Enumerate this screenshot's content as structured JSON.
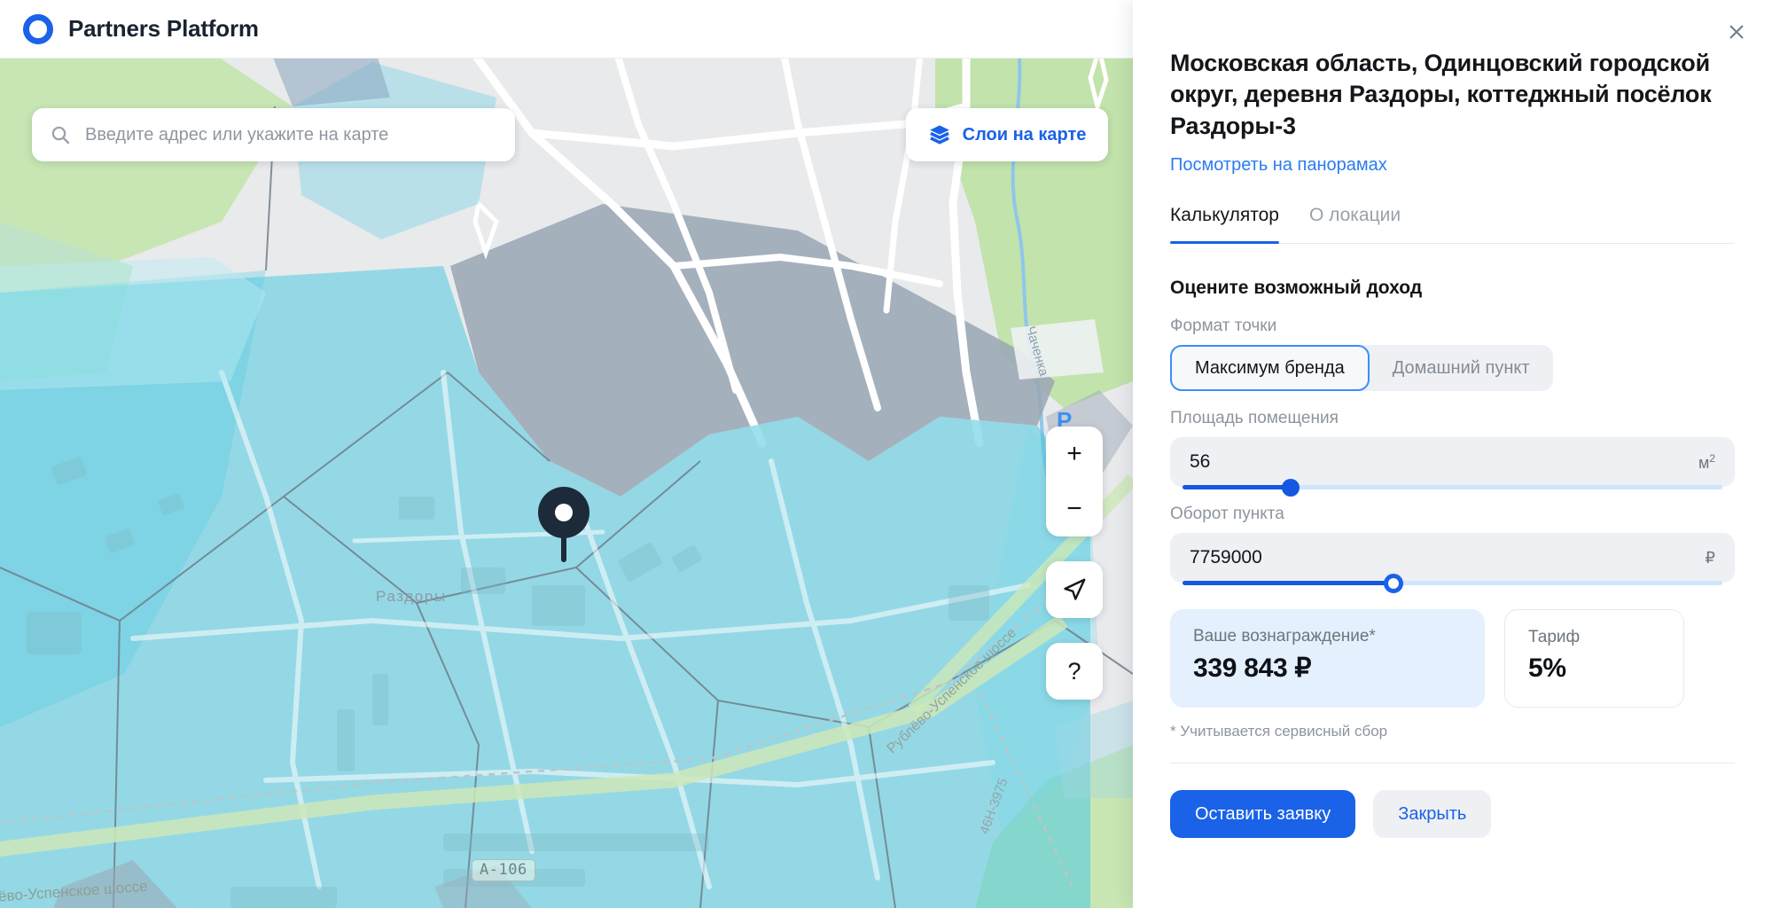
{
  "header": {
    "brand": "Partners Platform",
    "logo_icon": "ring-logo-icon",
    "logo_color": "#1a62e8"
  },
  "map": {
    "search": {
      "placeholder": "Введите адрес или укажите на карте",
      "value": "",
      "icon": "search-icon"
    },
    "layers_button": {
      "label": "Слои на карте",
      "icon": "layers-icon",
      "color": "#1a62e8"
    },
    "controls": {
      "zoom_in": "+",
      "zoom_out": "−",
      "locate_icon": "navigation-arrow-icon",
      "help": "?"
    },
    "pin": {
      "icon": "map-pin-icon",
      "color": "#1d2a3a"
    },
    "labels": {
      "settlement": "Раздоры",
      "river": "Чаченка",
      "highway_diagonal": "Рублёво-Успенское шоссе",
      "road_46h": "46H-3975",
      "highway_bottom": "лёво-Успенское шоссе",
      "road_shield": "A-106",
      "parking": "P"
    }
  },
  "panel": {
    "close_icon": "close-icon",
    "title": "Московская область, Одинцовский городской округ, деревня Раздоры, коттеджный посёлок Раздоры-3",
    "panorama_link": "Посмотреть на панорамах",
    "tabs": [
      {
        "label": "Калькулятор",
        "active": true
      },
      {
        "label": "О локации",
        "active": false
      }
    ],
    "section_title": "Оцените возможный доход",
    "point_format": {
      "label": "Формат точки",
      "options": [
        {
          "label": "Максимум бренда",
          "selected": true
        },
        {
          "label": "Домашний пункт",
          "selected": false
        }
      ]
    },
    "area": {
      "label": "Площадь помещения",
      "value": "56",
      "unit": "м",
      "unit_sup": "2",
      "slider_percent": 20
    },
    "turnover": {
      "label": "Оборот пункта",
      "value": "7759000",
      "unit": "₽",
      "slider_percent": 39
    },
    "reward_card": {
      "caption": "Ваше вознаграждение*",
      "value": "339 843 ₽"
    },
    "tariff_card": {
      "caption": "Тариф",
      "value": "5%"
    },
    "footnote": "* Учитывается сервисный сбор",
    "actions": {
      "primary": "Оставить заявку",
      "secondary": "Закрыть"
    }
  }
}
